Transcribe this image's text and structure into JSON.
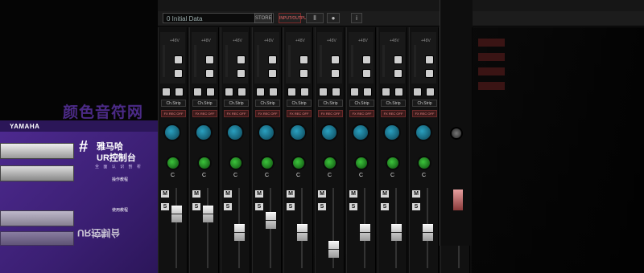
{
  "topbar": {
    "scene_label": "0  Initial Data",
    "store_label": "STORE",
    "red_label": "INPUT/OUTPUT"
  },
  "channel_strip": {
    "select_label": "Ch.Strip",
    "fx_label": "FX REC OFF",
    "pan_label": "C",
    "mute_label": "M",
    "solo_label": "S",
    "volume_label": "+48V"
  },
  "channels": [
    {
      "fader": 0.72
    },
    {
      "fader": 0.72
    },
    {
      "fader": 0.44
    },
    {
      "fader": 0.62
    },
    {
      "fader": 0.44
    },
    {
      "fader": 0.18
    },
    {
      "fader": 0.44
    },
    {
      "fader": 0.44
    },
    {
      "fader": 0.44
    },
    {
      "fader": 0.82
    }
  ],
  "banner": {
    "brand": "YAMAHA",
    "title_line1": "雅马哈",
    "title_line2": "UR控制台",
    "subtitle": "全 面 认 识 剖 析",
    "badge1": "操作教程",
    "badge2": "使用教程",
    "mirror_text": "UR控制台"
  },
  "watermark": "颜色音符网",
  "colors": {
    "accent_blue": "#2aa0c0",
    "accent_green": "#3cc43c",
    "accent_purple": "#4e2a90"
  }
}
